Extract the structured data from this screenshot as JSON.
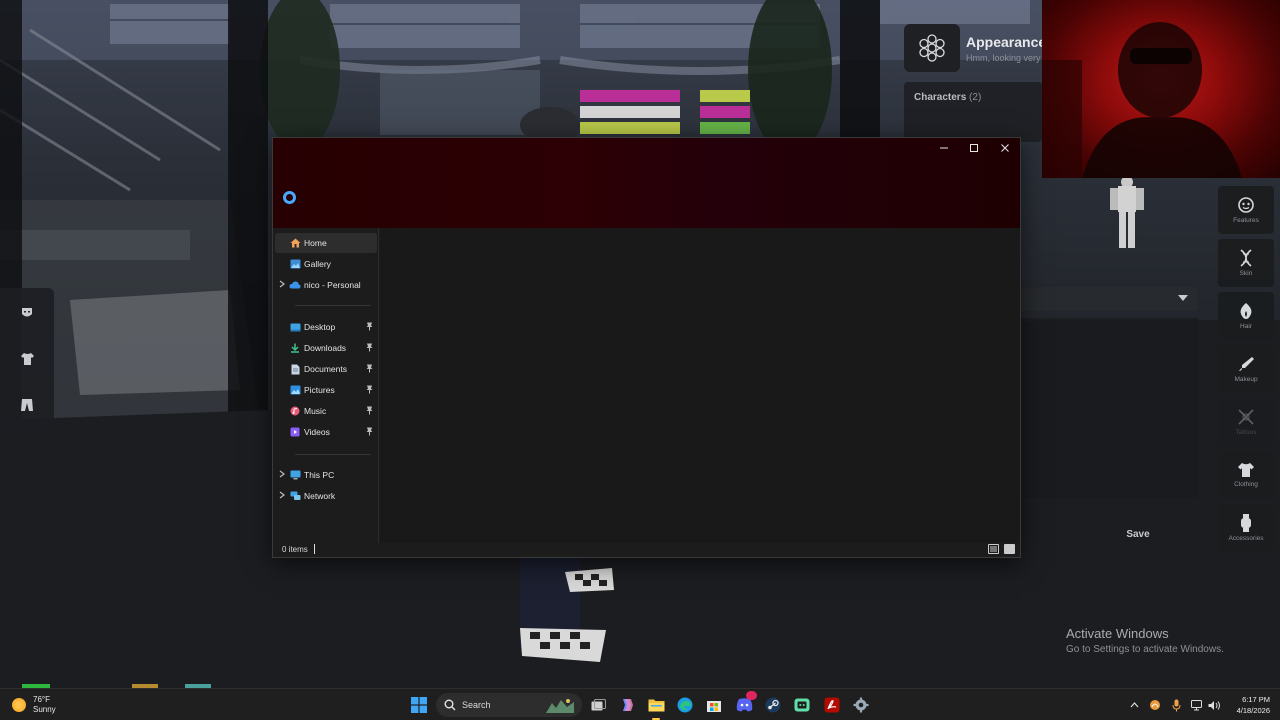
{
  "appearance": {
    "title": "Appearance",
    "subtitle": "Hmm, looking very",
    "characters_label": "Characters",
    "characters_count": "(2)",
    "save_label": "Save",
    "categories": [
      {
        "label": "Features",
        "icon": "face-features-icon",
        "enabled": true
      },
      {
        "label": "Skin",
        "icon": "dna-icon",
        "enabled": true
      },
      {
        "label": "Hair",
        "icon": "flame-hair-icon",
        "enabled": true
      },
      {
        "label": "Makeup",
        "icon": "brush-icon",
        "enabled": true
      },
      {
        "label": "Tattoos",
        "icon": "tattoo-icon",
        "enabled": false
      },
      {
        "label": "Clothing",
        "icon": "shirt-icon",
        "enabled": true
      },
      {
        "label": "Accessories",
        "icon": "watch-icon",
        "enabled": true
      }
    ]
  },
  "left_hud": [
    {
      "icon": "mask-icon"
    },
    {
      "icon": "shirt-icon"
    },
    {
      "icon": "pants-icon"
    }
  ],
  "explorer": {
    "nav_items": [
      {
        "label": "Home",
        "icon": "home-icon",
        "selected": true,
        "expandable": false,
        "pinned": false
      },
      {
        "label": "Gallery",
        "icon": "gallery-icon",
        "selected": false,
        "expandable": false,
        "pinned": false
      },
      {
        "label": "nico - Personal",
        "icon": "onedrive-cloud-icon",
        "selected": false,
        "expandable": true,
        "pinned": false
      },
      {
        "label": "Desktop",
        "icon": "desktop-icon",
        "selected": false,
        "expandable": false,
        "pinned": true
      },
      {
        "label": "Downloads",
        "icon": "download-icon",
        "selected": false,
        "expandable": false,
        "pinned": true
      },
      {
        "label": "Documents",
        "icon": "document-icon",
        "selected": false,
        "expandable": false,
        "pinned": true
      },
      {
        "label": "Pictures",
        "icon": "pictures-icon",
        "selected": false,
        "expandable": false,
        "pinned": true
      },
      {
        "label": "Music",
        "icon": "music-icon",
        "selected": false,
        "expandable": false,
        "pinned": true
      },
      {
        "label": "Videos",
        "icon": "videos-icon",
        "selected": false,
        "expandable": false,
        "pinned": true
      },
      {
        "label": "This PC",
        "icon": "this-pc-icon",
        "selected": false,
        "expandable": true,
        "pinned": false
      },
      {
        "label": "Network",
        "icon": "network-icon",
        "selected": false,
        "expandable": true,
        "pinned": false
      }
    ],
    "status": {
      "items": "0 items"
    }
  },
  "activation": {
    "title": "Activate Windows",
    "subtitle": "Go to Settings to activate Windows."
  },
  "taskbar": {
    "weather": {
      "temp": "76°F",
      "condition": "Sunny"
    },
    "search_label": "Search",
    "apps": [
      {
        "icon": "windows-start-icon"
      },
      {
        "icon": "task-view-icon"
      },
      {
        "icon": "copilot-icon"
      },
      {
        "icon": "file-explorer-icon",
        "active": true
      },
      {
        "icon": "edge-browser-icon"
      },
      {
        "icon": "microsoft-store-icon"
      },
      {
        "icon": "discord-icon",
        "badge": "9+"
      },
      {
        "icon": "steam-icon"
      },
      {
        "icon": "app-icon"
      },
      {
        "icon": "adobe-acrobat-icon"
      },
      {
        "icon": "settings-gear-icon"
      }
    ],
    "time": "6:17 PM",
    "date": "4/18/2026"
  },
  "colors": {
    "accent": "#4aa8ff",
    "titlebar_tint": "#2a0004",
    "webcam_red": "#c01818",
    "taskbar_active": "#ffcb3c"
  }
}
